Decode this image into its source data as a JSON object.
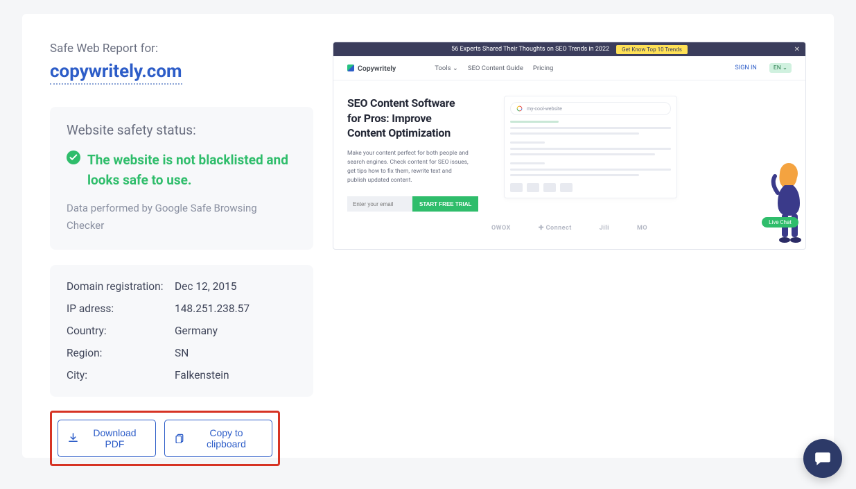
{
  "header": {
    "label": "Safe Web Report for:",
    "domain": "copywritely.com"
  },
  "status_panel": {
    "title": "Website safety status:",
    "message": "The website is not blacklisted and looks safe to use.",
    "provider_note": "Data performed by Google Safe Browsing Checker"
  },
  "info": {
    "rows": [
      {
        "label": "Domain registration:",
        "value": "Dec 12, 2015"
      },
      {
        "label": "IP adress:",
        "value": "148.251.238.57"
      },
      {
        "label": "Country:",
        "value": "Germany"
      },
      {
        "label": "Region:",
        "value": "SN"
      },
      {
        "label": "City:",
        "value": "Falkenstein"
      }
    ]
  },
  "actions": {
    "download": "Download PDF",
    "copy": "Copy to clipboard"
  },
  "preview": {
    "banner_text": "56 Experts Shared Their Thoughts on SEO Trends in 2022",
    "banner_cta": "Get Know Top 10 Trends",
    "brand": "Copywritely",
    "nav": {
      "tools": "Tools",
      "guide": "SEO Content Guide",
      "pricing": "Pricing"
    },
    "signin": "SIGN IN",
    "lang": "EN",
    "hero_title_l1": "SEO Content Software",
    "hero_title_l2": "for Pros: Improve",
    "hero_title_l3": "Content Optimization",
    "hero_desc": "Make your content perfect for both people and search engines. Check content for SEO issues, get tips how to fix them, rewrite text and publish updated content.",
    "email_placeholder": "Enter your email",
    "start_btn": "START FREE TRIAL",
    "search_placeholder": "my-cool-website",
    "livechat": "Live Chat",
    "logos": {
      "a": "OWOX",
      "b": "Connect",
      "c": "Jili",
      "d": "MO"
    }
  },
  "colors": {
    "accent_blue": "#2d5dc8",
    "success_green": "#2fbd6b",
    "highlight_red": "#d63324"
  }
}
